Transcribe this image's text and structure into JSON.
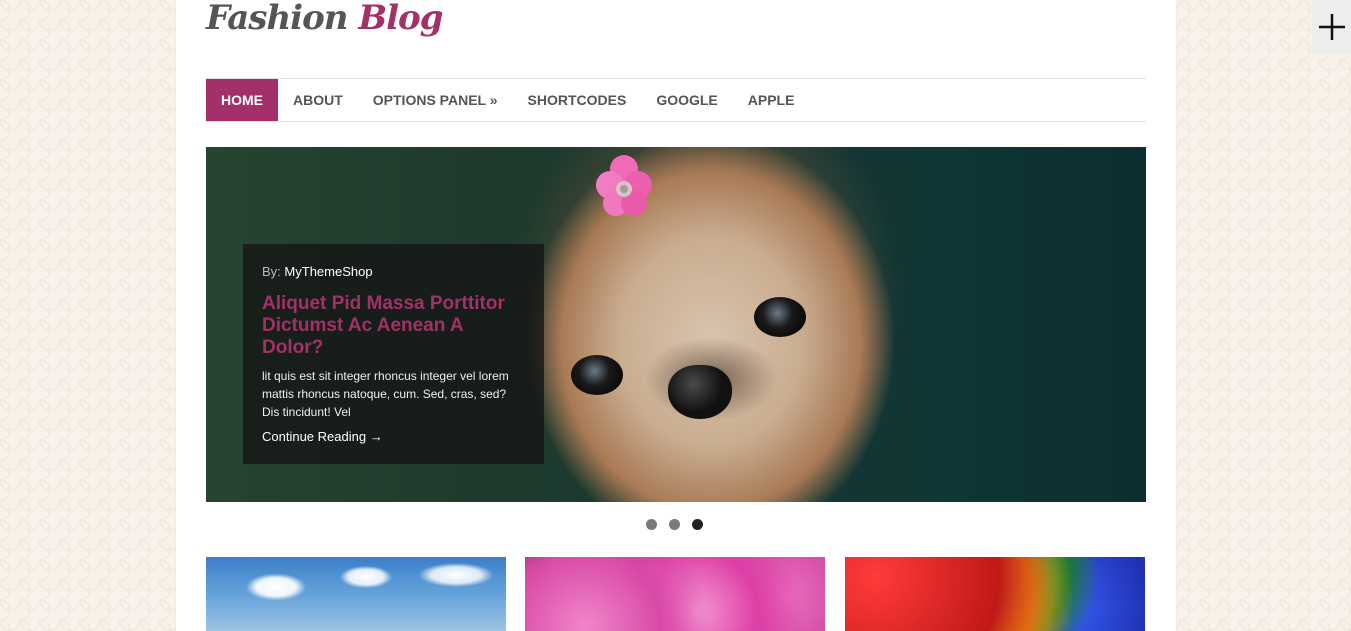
{
  "site": {
    "logo_word1": "Fashion",
    "logo_word2": "Blog",
    "accent_color": "#a33068"
  },
  "nav": {
    "items": [
      {
        "label": "HOME",
        "active": true
      },
      {
        "label": "ABOUT"
      },
      {
        "label": "OPTIONS PANEL »"
      },
      {
        "label": "SHORTCODES"
      },
      {
        "label": "GOOGLE"
      },
      {
        "label": "APPLE"
      }
    ]
  },
  "slider": {
    "by_label": "By:",
    "author": "MyThemeShop",
    "title": "Aliquet Pid Massa Porttitor Dictumst Ac Aenean A Dolor?",
    "excerpt": "lit quis est sit integer rhoncus integer vel lorem mattis rhoncus natoque, cum. Sed, cras, sed? Dis tincidunt! Vel",
    "read_more": "Continue Reading →",
    "dots_count": 3,
    "active_dot": 3
  },
  "thumbnails": [
    {
      "subject": "sky-clouds-image"
    },
    {
      "subject": "pink-dahlias-image"
    },
    {
      "subject": "rainbow-roses-image"
    }
  ],
  "corner_button": {
    "icon": "plus-icon"
  }
}
